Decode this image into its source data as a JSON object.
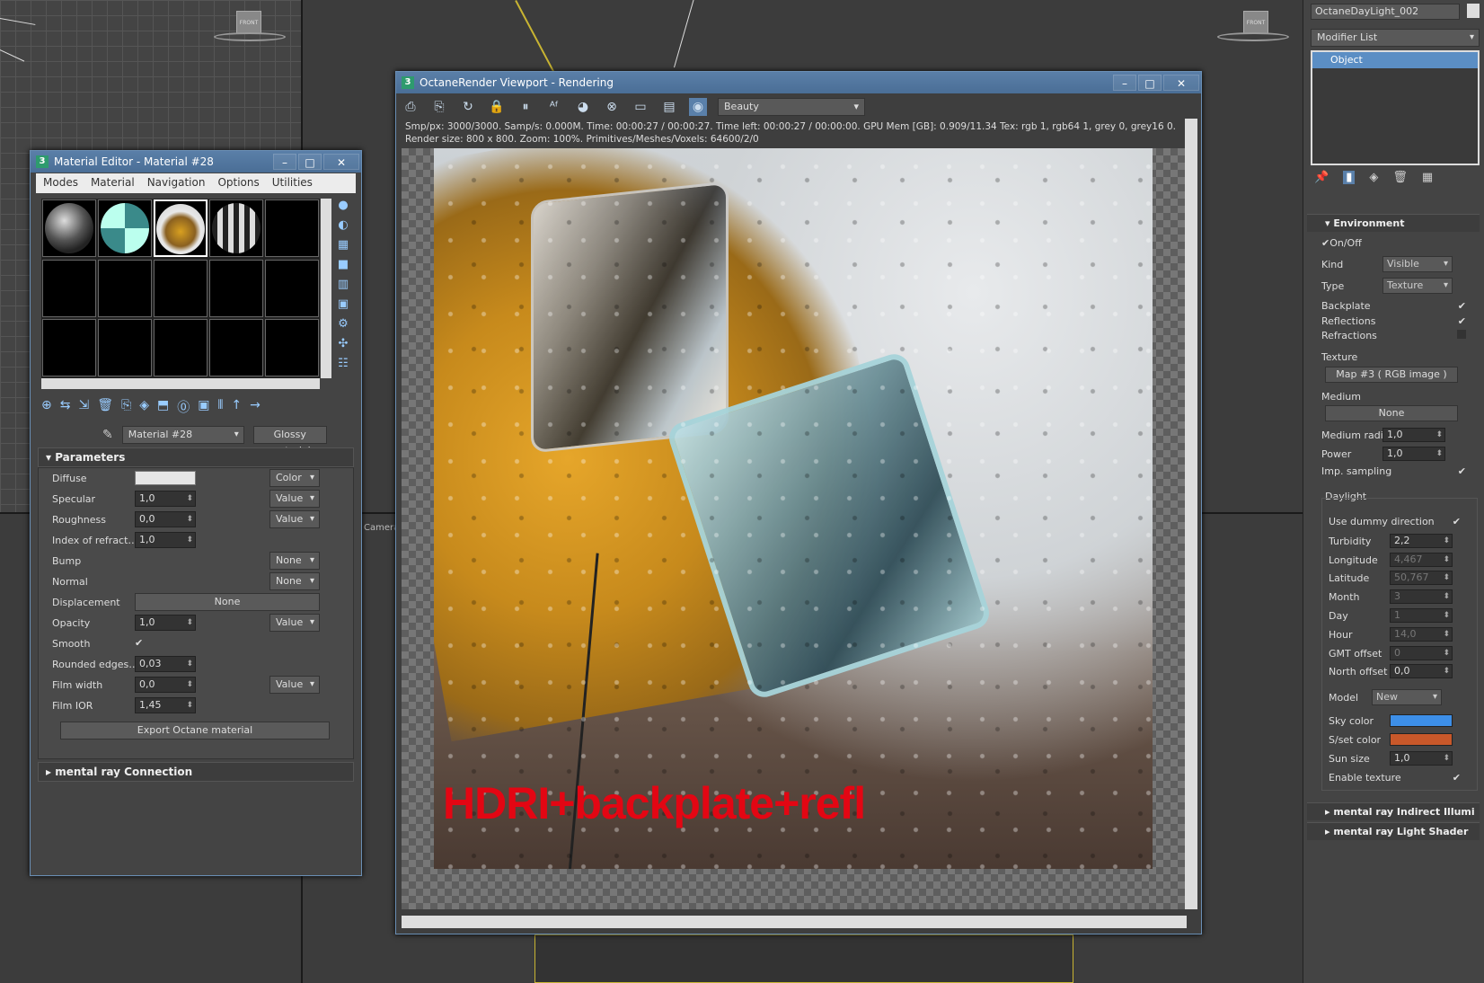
{
  "viewport": {
    "camera_label": "Camera",
    "gizmo_label": "FRONT"
  },
  "material_editor": {
    "title": "Material Editor - Material #28",
    "menu": [
      "Modes",
      "Material",
      "Navigation",
      "Options",
      "Utilities"
    ],
    "material_name": "Material #28",
    "material_type": "Glossy material",
    "parameters_title": "Parameters",
    "params": {
      "diffuse": {
        "label": "Diffuse",
        "mode": "Color"
      },
      "specular": {
        "label": "Specular",
        "value": "1,0",
        "mode": "Value"
      },
      "roughness": {
        "label": "Roughness",
        "value": "0,0",
        "mode": "Value"
      },
      "ior": {
        "label": "Index of refract…",
        "value": "1,0"
      },
      "bump": {
        "label": "Bump",
        "mode": "None"
      },
      "normal": {
        "label": "Normal",
        "mode": "None"
      },
      "displacement": {
        "label": "Displacement",
        "value": "None"
      },
      "opacity": {
        "label": "Opacity",
        "value": "1,0",
        "mode": "Value"
      },
      "smooth": {
        "label": "Smooth",
        "checked": "✔"
      },
      "rounded": {
        "label": "Rounded edges…",
        "value": "0,03"
      },
      "film_width": {
        "label": "Film width",
        "value": "0,0",
        "mode": "Value"
      },
      "film_ior": {
        "label": "Film IOR",
        "value": "1,45"
      }
    },
    "export_button": "Export Octane material",
    "mental_ray_connection": "mental ray Connection",
    "icon_names": [
      "sphere-icon",
      "backlight-icon",
      "checker-icon",
      "bg-icon",
      "color-check-icon",
      "video-icon",
      "options-icon",
      "select-by-material-icon",
      "material-map-icon"
    ]
  },
  "octane": {
    "title": "OctaneRender Viewport - Rendering",
    "pass": "Beauty",
    "stats_line1": "Smp/px: 3000/3000.    Samp/s: 0.000M.    Time: 00:00:27 / 00:00:27.    Time left: 00:00:27 / 00:00:00.    GPU Mem [GB]: 0.909/11.34    Tex: rgb 1, rgb64 1, grey 0, grey16 0.",
    "stats_line2": "Render size: 800 x 800.    Zoom: 100%.    Primitives/Meshes/Voxels: 64600/2/0",
    "caption": "HDRI+backplate+refl"
  },
  "command_panel": {
    "object_name": "OctaneDayLight_002",
    "modifier_list": "Modifier List",
    "stack_item": "Object",
    "environment": {
      "title": "Environment",
      "onoff": "On/Off",
      "kind_label": "Kind",
      "kind": "Visible",
      "type_label": "Type",
      "type": "Texture",
      "backplate": "Backplate",
      "reflections": "Reflections",
      "refractions": "Refractions",
      "texture_label": "Texture",
      "texture": "Map #3  ( RGB image )",
      "medium_label": "Medium",
      "medium": "None",
      "medium_radius_label": "Medium radius",
      "medium_radius": "1,0",
      "power_label": "Power",
      "power": "1,0",
      "imp_sampling": "Imp. sampling"
    },
    "daylight": {
      "title": "Daylight",
      "use_dummy": "Use dummy direction",
      "turbidity_label": "Turbidity",
      "turbidity": "2,2",
      "longitude_label": "Longitude",
      "longitude": "4,467",
      "latitude_label": "Latitude",
      "latitude": "50,767",
      "month_label": "Month",
      "month": "3",
      "day_label": "Day",
      "day": "1",
      "hour_label": "Hour",
      "hour": "14,0",
      "gmt_label": "GMT offset",
      "gmt": "0",
      "north_label": "North offset",
      "north": "0,0",
      "model_label": "Model",
      "model": "New",
      "sky_label": "Sky color",
      "sky_color": "#3d8fe8",
      "sunset_label": "S/set color",
      "sunset_color": "#c8582a",
      "sunsize_label": "Sun size",
      "sunsize": "1,0",
      "enable_texture": "Enable texture"
    },
    "indirect": "mental ray Indirect Illumi",
    "light_shader": "mental ray Light Shader"
  }
}
